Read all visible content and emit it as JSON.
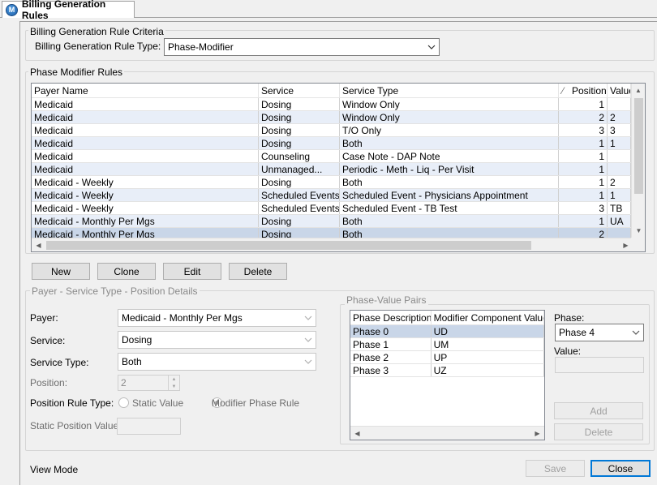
{
  "tab": {
    "title": "Billing Generation Rules",
    "icon_letter": "M"
  },
  "criteria": {
    "group_title": "Billing Generation Rule Criteria",
    "rule_type_label": "Billing Generation Rule Type:",
    "rule_type_value": "Phase-Modifier"
  },
  "rules": {
    "group_title": "Phase Modifier Rules",
    "columns": [
      "Payer Name",
      "Service",
      "Service Type",
      "Position",
      "Value"
    ],
    "rows": [
      {
        "payer": "Medicaid",
        "service": "Dosing",
        "service_type": "Window Only",
        "position": "1",
        "value": ""
      },
      {
        "payer": "Medicaid",
        "service": "Dosing",
        "service_type": "Window Only",
        "position": "2",
        "value": "2"
      },
      {
        "payer": "Medicaid",
        "service": "Dosing",
        "service_type": "T/O Only",
        "position": "3",
        "value": "3"
      },
      {
        "payer": "Medicaid",
        "service": "Dosing",
        "service_type": "Both",
        "position": "1",
        "value": "1"
      },
      {
        "payer": "Medicaid",
        "service": "Counseling",
        "service_type": "Case Note - DAP Note",
        "position": "1",
        "value": ""
      },
      {
        "payer": "Medicaid",
        "service": "Unmanaged...",
        "service_type": "Periodic - Meth - Liq - Per Visit",
        "position": "1",
        "value": ""
      },
      {
        "payer": "Medicaid - Weekly",
        "service": "Dosing",
        "service_type": "Both",
        "position": "1",
        "value": "2"
      },
      {
        "payer": "Medicaid - Weekly",
        "service": "Scheduled Events",
        "service_type": "Scheduled Event - Physicians Appointment",
        "position": "1",
        "value": "1"
      },
      {
        "payer": "Medicaid - Weekly",
        "service": "Scheduled Events",
        "service_type": "Scheduled Event - TB Test",
        "position": "3",
        "value": "TB"
      },
      {
        "payer": "Medicaid - Monthly Per Mgs",
        "service": "Dosing",
        "service_type": "Both",
        "position": "1",
        "value": "UA"
      },
      {
        "payer": "Medicaid - Monthly Per Mgs",
        "service": "Dosing",
        "service_type": "Both",
        "position": "2",
        "value": ""
      }
    ]
  },
  "actions": {
    "new": "New",
    "clone": "Clone",
    "edit": "Edit",
    "delete": "Delete"
  },
  "details": {
    "group_title": "Payer - Service Type - Position Details",
    "payer_label": "Payer:",
    "payer_value": "Medicaid - Monthly Per Mgs",
    "service_label": "Service:",
    "service_value": "Dosing",
    "service_type_label": "Service Type:",
    "service_type_value": "Both",
    "position_label": "Position:",
    "position_value": "2",
    "position_rule_label": "Position Rule Type:",
    "static_value_option": "Static Value",
    "modifier_phase_option": "Modifier Phase Rule",
    "static_position_label": "Static Position Value:",
    "static_position_value": ""
  },
  "pairs": {
    "group_title": "Phase-Value Pairs",
    "columns": [
      "Phase Description",
      "Modifier Component Value"
    ],
    "rows": [
      {
        "phase": "Phase 0",
        "value": "UD"
      },
      {
        "phase": "Phase 1",
        "value": "UM"
      },
      {
        "phase": "Phase 2",
        "value": "UP"
      },
      {
        "phase": "Phase 3",
        "value": "UZ"
      }
    ],
    "phase_label": "Phase:",
    "phase_value": "Phase 4",
    "value_label": "Value:",
    "value_value": "",
    "add": "Add",
    "delete": "Delete"
  },
  "footer": {
    "mode": "View Mode",
    "save": "Save",
    "close": "Close"
  },
  "colors": {
    "selected_row": "#c9d6e8",
    "alt_row": "#e8eef8",
    "default_button_border": "#0078d7"
  }
}
